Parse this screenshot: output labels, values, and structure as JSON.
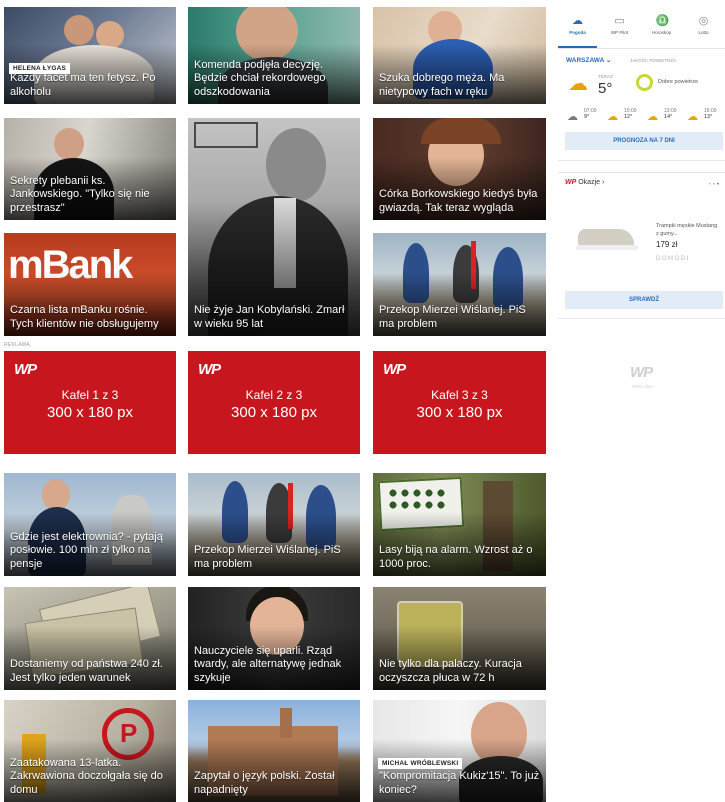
{
  "tiles": [
    {
      "caption": "Każdy facet ma ten fetysz. Po alkoholu",
      "author": "HELENA ŁYGAS"
    },
    {
      "caption": "Komenda podjęła decyzję. Będzie chciał rekordowego odszkodowania"
    },
    {
      "caption": "Szuka dobrego męża. Ma nietypowy fach w ręku"
    },
    {
      "caption": "Sekrety plebanii ks. Jankowskiego. \"Tylko się nie przestrasz\""
    },
    {
      "caption": "Nie żyje Jan Kobylański. Zmarł w wieku 95 lat"
    },
    {
      "caption": "Córka Borkowskiego kiedyś była gwiazdą. Tak teraz wygląda"
    },
    {
      "caption": "Czarna lista mBanku rośnie. Tych klientów nie obsługujemy",
      "image_text": "mBank"
    },
    {
      "caption": "Przekop Mierzei Wiślanej. PiS ma problem"
    },
    {
      "caption": "Gdzie jest elektrownia? - pytają posłowie. 100 mln zł tylko na pensje"
    },
    {
      "caption": "Przekop Mierzei Wiślanej. PiS ma problem"
    },
    {
      "caption": "Lasy biją na alarm. Wzrost aż o 1000 proc."
    },
    {
      "caption": "Dostaniemy od państwa 240 zł. Jest tylko jeden warunek"
    },
    {
      "caption": "Nauczyciele się uparli. Rząd twardy, ale alternatywę jednak szykuje"
    },
    {
      "caption": "Nie tylko dla palaczy. Kuracja oczyszcza płuca w 72 h"
    },
    {
      "caption": "Zaatakowana 13-latka. Zakrwawiona doczołgała się do domu"
    },
    {
      "caption": "Zapytał o język polski. Został napadnięty"
    },
    {
      "caption": "\"Kompromitacja Kukiz'15\". To już koniec?",
      "author": "MICHAŁ WRÓBLEWSKI"
    }
  ],
  "ad_label": "REKLAMA",
  "ads": [
    {
      "logo": "WP",
      "line1": "Kafel 1 z 3",
      "line2": "300 x 180 px"
    },
    {
      "logo": "WP",
      "line1": "Kafel 2 z 3",
      "line2": "300 x 180 px"
    },
    {
      "logo": "WP",
      "line1": "Kafel 3 z 3",
      "line2": "300 x 180 px"
    }
  ],
  "sidebar": {
    "tabs": [
      "Pogoda",
      "WP Pilot",
      "Horoskop",
      "Lotto"
    ],
    "weather": {
      "city": "WARSZAWA",
      "air_label": "JAKOŚĆ POWIETRZA",
      "now_label": "TERAZ",
      "now_temp": "5°",
      "air_status": "Dobre powietrze",
      "hours": [
        {
          "time": "07:00",
          "temp": "9°"
        },
        {
          "time": "10:00",
          "temp": "12°"
        },
        {
          "time": "13:00",
          "temp": "14°"
        },
        {
          "time": "16:00",
          "temp": "13°"
        }
      ],
      "forecast_button": "PROGNOZA NA 7 DNI"
    },
    "offers": {
      "brand": "WP",
      "title": "Okazje ›",
      "product": "Trampki męskie Mustang z gumy...",
      "price": "179 zł",
      "shop": "DOMODI",
      "button": "SPRAWDŹ"
    },
    "ad_logo": "WP",
    "ad_text": "REKLAMA"
  },
  "colors": {
    "accent": "#c8161e",
    "blue": "#2a6bb8"
  }
}
